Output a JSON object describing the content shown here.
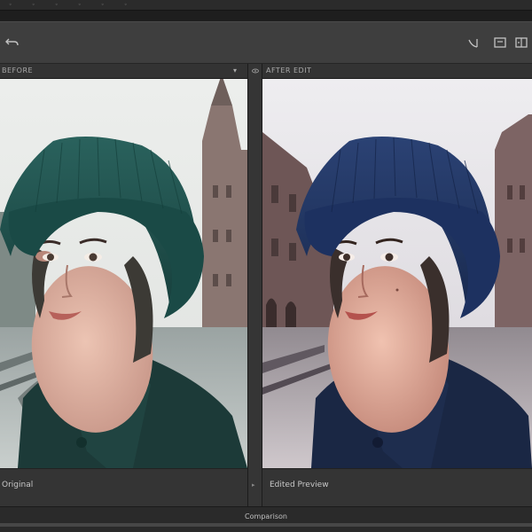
{
  "window": {
    "tabs": [
      "◦",
      "◦",
      "◦",
      "◦",
      "◦",
      "◦"
    ]
  },
  "toolbar": {
    "undo_icon": "undo-icon",
    "right_icons": [
      "crop-icon",
      "compare-icon",
      "split-view-icon"
    ]
  },
  "panels": {
    "before": {
      "header": "BEFORE",
      "menu_glyph": "▾",
      "caption": "Original"
    },
    "after": {
      "header": "AFTER EDIT",
      "caption": "Edited Preview"
    }
  },
  "status": {
    "text": "Comparison"
  },
  "colors": {
    "before_hat": "#1f4f4c",
    "before_coat": "#1c3a38",
    "after_hat": "#22345a",
    "after_coat": "#1a2744",
    "skin": "#e3b7a6",
    "background_sky": "#e9ebe9",
    "building": "#7d6a6a"
  }
}
